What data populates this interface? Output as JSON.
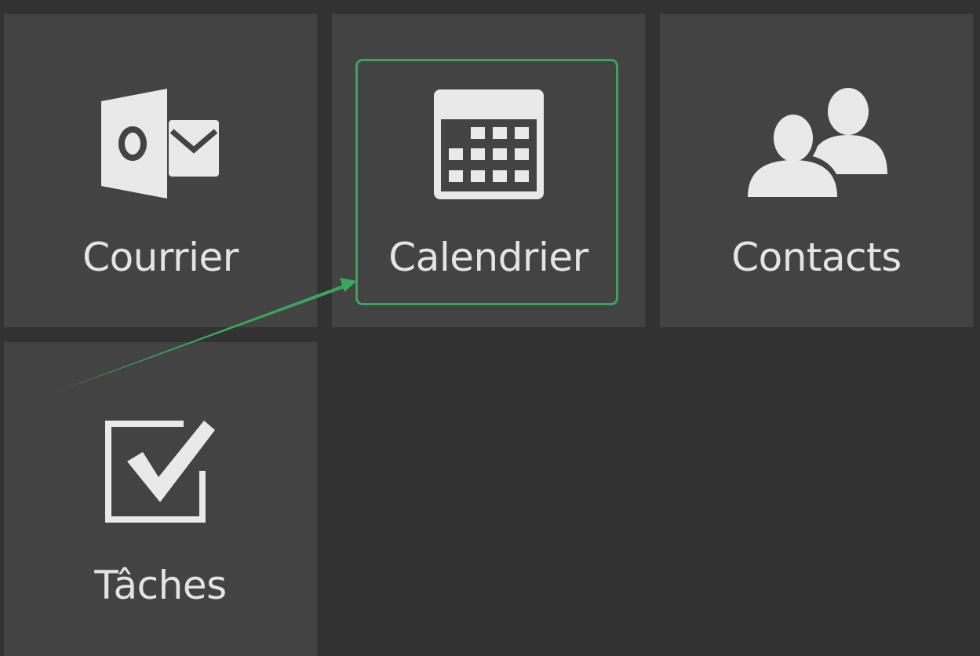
{
  "tiles": [
    {
      "id": "mail",
      "label": "Courrier",
      "icon": "outlook-mail-icon"
    },
    {
      "id": "calendar",
      "label": "Calendrier",
      "icon": "calendar-icon"
    },
    {
      "id": "contacts",
      "label": "Contacts",
      "icon": "people-icon"
    },
    {
      "id": "tasks",
      "label": "Tâches",
      "icon": "checkbox-icon"
    }
  ],
  "colors": {
    "background": "#323232",
    "tile": "#434343",
    "icon": "#e9e9e9",
    "label": "#e4e4e4",
    "highlight": "#3aa55d"
  }
}
